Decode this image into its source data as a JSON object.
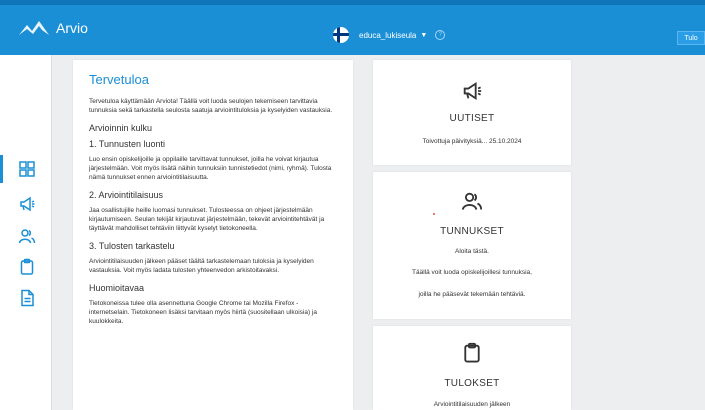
{
  "header": {
    "app_name": "Arvio",
    "school_select": "educa_lukiseula",
    "help_mark": "?",
    "login_button": "Tulo"
  },
  "sidebar": {
    "items": [
      {
        "icon": "dashboard-icon"
      },
      {
        "icon": "megaphone-icon"
      },
      {
        "icon": "users-icon"
      },
      {
        "icon": "clipboard-icon"
      },
      {
        "icon": "document-icon"
      }
    ]
  },
  "main": {
    "title": "Tervetuloa",
    "intro": "Tervetuloa käyttämään Arviota! Täällä voit luoda seulojen tekemiseen tarvittavia tunnuksia sekä tarkastella seulosta saatuja arviointituloksia ja kyselyiden vastauksia.",
    "section_heading": "Arvioinnin kulku",
    "step1_heading": "1. Tunnusten luonti",
    "step1_text": "Luo ensin opiskelijoille ja oppilaille tarvittavat tunnukset, joilla he voivat kirjautua järjestelmään. Voit myös lisätä näihin tunnuksiin tunnistetiedot (nimi, ryhmä). Tulosta nämä tunnukset ennen arviointitilaisuutta.",
    "step2_heading": "2. Arviointitilaisuus",
    "step2_text": "Jaa osallistujille heille luomasi tunnukset. Tulosteessa on ohjeet järjestelmään kirjautumiseen. Seulan tekijät kirjautuvat järjestelmään, tekevät arviointitehtävät ja täyttävät mahdolliset tehtäviin liittyvät kyselyt tietokoneella.",
    "step3_heading": "3. Tulosten tarkastelu",
    "step3_text": "Arviointitilaisuuden jälkeen pääset täältä tarkastelemaan tuloksia ja kyselyiden vastauksia. Voit myös ladata tulosten yhteenvedon arkistoitavaksi.",
    "notice_heading": "Huomioitavaa",
    "notice_text": "Tietokoneissa tulee olla asennettuna Google Chrome tai Mozilla Firefox -internetselain. Tietokoneen lisäksi tarvitaan myös hiirtä (suositellaan ulkoisia) ja kuulokkeita."
  },
  "cards": {
    "news": {
      "title": "UUTISET",
      "text": "Toivottuja päivityksiä...   25.10.2024"
    },
    "users": {
      "title": "TUNNUKSET",
      "line1": "Aloita tästä.",
      "line2": "Täällä voit luoda opiskelijoillesi tunnuksia,",
      "line3": "joilla he pääsevät tekemään tehtäviä."
    },
    "results": {
      "title": "TULOKSET",
      "text": "Arviointitilaisuuden jälkeen"
    }
  },
  "colors": {
    "accent": "#1a8fd6",
    "background": "#edeef0"
  }
}
